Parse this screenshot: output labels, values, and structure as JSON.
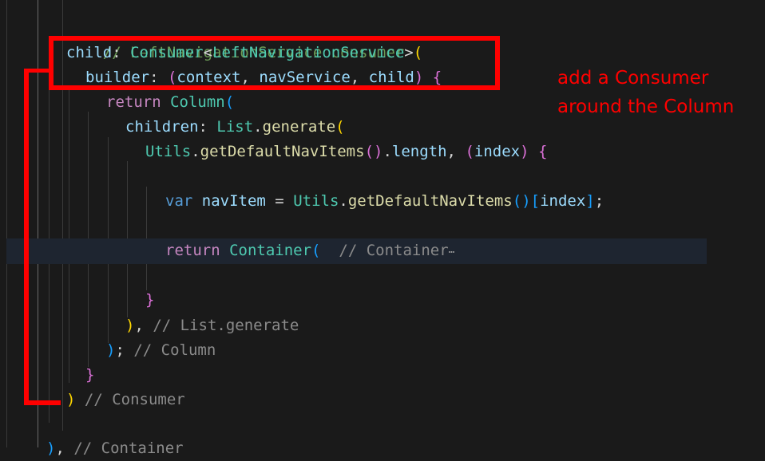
{
  "editor": {
    "lines": {
      "comment_consumer": "// LeftNavigationService consumer",
      "child_prop": "child",
      "consumer_type": "Consumer",
      "lnav_type": "LeftNavigationService",
      "builder_prop": "builder",
      "params": [
        "context",
        "navService",
        "child"
      ],
      "return_kw": "return",
      "column_type": "Column",
      "children_prop": "children",
      "list_type": "List",
      "generate_fn": "generate",
      "utils_type": "Utils",
      "get_items_fn": "getDefaultNavItems",
      "length_prop": "length",
      "index_param": "index",
      "var_kw": "var",
      "navitem_var": "navItem",
      "container_type": "Container",
      "container_comment": "// Container",
      "fold_ellipsis": "⋯",
      "list_generate_comment": "// List.generate",
      "column_comment": "// Column",
      "consumer_comment": "// Consumer",
      "container_end_comment": "// Container"
    }
  },
  "annotation": {
    "line1": "add a Consumer",
    "line2": "around the Column",
    "color": "#ff0000"
  }
}
